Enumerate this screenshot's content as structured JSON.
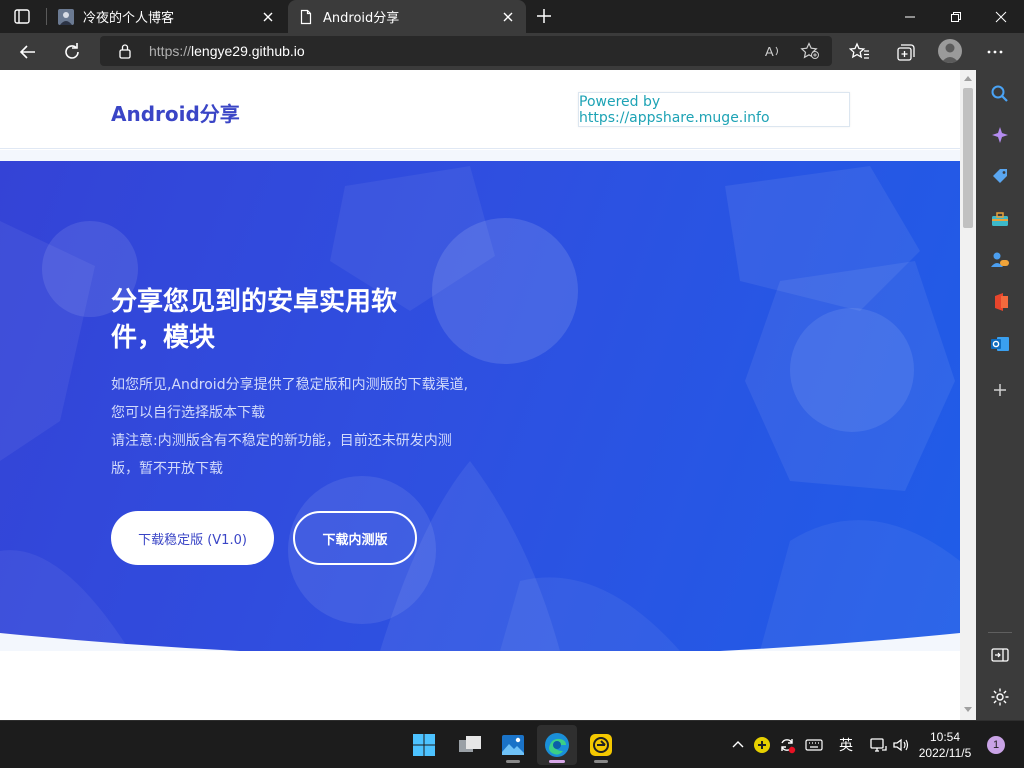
{
  "browser": {
    "tabs": [
      {
        "title": "冷夜的个人博客",
        "active": false
      },
      {
        "title": "Android分享",
        "active": true
      }
    ],
    "address": {
      "scheme": "https://",
      "host": "lengye29.github.io"
    }
  },
  "site": {
    "brand": "Android分享",
    "powered_by": "Powered by https://appshare.muge.info",
    "hero": {
      "title": "分享您见到的安卓实用软件，模块",
      "desc_line1": "如您所见,Android分享提供了稳定版和内测版的下载渠道,您可以自行选择版本下载",
      "desc_line2": "请注意:内测版含有不稳定的新功能，目前还未研发内测版，暂不开放下载",
      "btn_stable": "下载稳定版 (V1.0)",
      "btn_beta": "下载内测版"
    }
  },
  "taskbar": {
    "ime": "英",
    "time": "10:54",
    "date": "2022/11/5",
    "notifications": "1"
  },
  "colors": {
    "brand": "#3a45c6",
    "hero_start": "#3443d6",
    "hero_end": "#1f5de8",
    "powered": "#1ea3b5"
  }
}
